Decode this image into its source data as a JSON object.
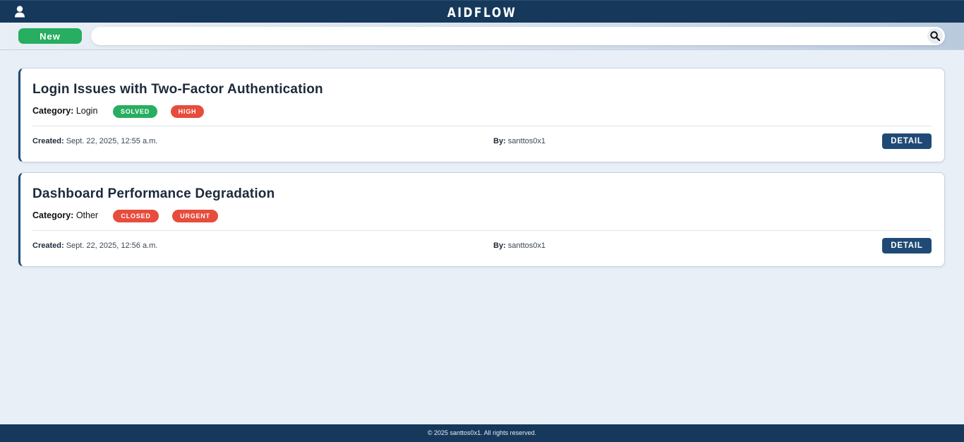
{
  "header": {
    "brand": "AIDFLOW",
    "user_icon": "user-icon"
  },
  "toolbar": {
    "new_label": "New",
    "search_placeholder": "",
    "search_value": "",
    "search_icon": "search-icon"
  },
  "tickets": [
    {
      "title": "Login Issues with Two-Factor Authentication",
      "category_label": "Category:",
      "category": "Login",
      "status": "SOLVED",
      "status_color": "#27ae60",
      "priority": "HIGH",
      "priority_color": "#e74c3c",
      "created_label": "Created:",
      "created": "Sept. 22, 2025, 12:55 a.m.",
      "by_label": "By:",
      "by": "santtos0x1",
      "detail_label": "DETAIL"
    },
    {
      "title": "Dashboard Performance Degradation",
      "category_label": "Category:",
      "category": "Other",
      "status": "CLOSED",
      "status_color": "#e74c3c",
      "priority": "URGENT",
      "priority_color": "#e74c3c",
      "created_label": "Created:",
      "created": "Sept. 22, 2025, 12:56 a.m.",
      "by_label": "By:",
      "by": "santtos0x1",
      "detail_label": "DETAIL"
    }
  ],
  "footer": {
    "text": "© 2025 santtos0x1. All rights reserved."
  }
}
